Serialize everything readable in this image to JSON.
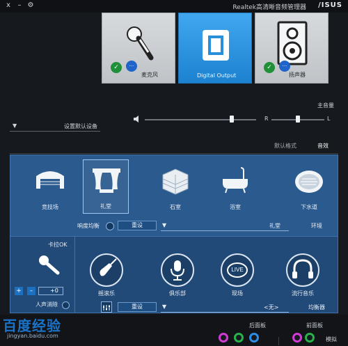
{
  "titlebar": {
    "brand": "/ISUS",
    "title": "Realtek高清晰音频管理器",
    "close": "x",
    "minimize": "–",
    "settings": "⚙"
  },
  "devices": [
    {
      "label": "麦克风",
      "icon": "microphone-icon"
    },
    {
      "label": "Digital Output",
      "icon": "digital-output-icon"
    },
    {
      "label": "扬声器",
      "icon": "speaker-icon"
    }
  ],
  "volume": {
    "main_label": "主音量",
    "left": "L",
    "right": "R",
    "balance": 0.5,
    "level": 0.22
  },
  "default_device": {
    "label": "设置默认设备"
  },
  "tabs": [
    {
      "label": "音效",
      "active": true
    },
    {
      "label": "默认格式",
      "active": false
    }
  ],
  "environment": {
    "items": [
      {
        "label": "下水道",
        "icon": "sewer-icon"
      },
      {
        "label": "浴室",
        "icon": "bathtub-icon"
      },
      {
        "label": "石室",
        "icon": "stone-room-icon"
      },
      {
        "label": "礼堂",
        "icon": "auditorium-icon",
        "selected": true
      },
      {
        "label": "竞技场",
        "icon": "arena-icon"
      }
    ],
    "row_label": "环境",
    "current": "礼堂",
    "reset_label": "重设",
    "toggle_label": "响度均衡"
  },
  "equalizer": {
    "items": [
      {
        "label": "流行音乐",
        "icon": "headphones-icon"
      },
      {
        "label": "现场",
        "icon": "live-music-icon"
      },
      {
        "label": "俱乐部",
        "icon": "club-microphone-icon"
      },
      {
        "label": "摇滚乐",
        "icon": "rock-guitar-icon"
      }
    ],
    "row_label": "均衡器",
    "current": "<无>",
    "reset_label": "重设"
  },
  "karaoke": {
    "label": "卡拉OK",
    "value": "+0",
    "voice_cancel": "人声消除",
    "plus": "+",
    "minus": "–"
  },
  "bottom": {
    "front_label": "前面板",
    "rear_label": "后面板",
    "analog_label": "模拟"
  },
  "jack_colors": {
    "pink": "#d23bd3",
    "green": "#27b34a",
    "blue": "#2a8fe8"
  },
  "watermark": {
    "big": "百度经验",
    "small": "jingyan.baidu.com"
  }
}
